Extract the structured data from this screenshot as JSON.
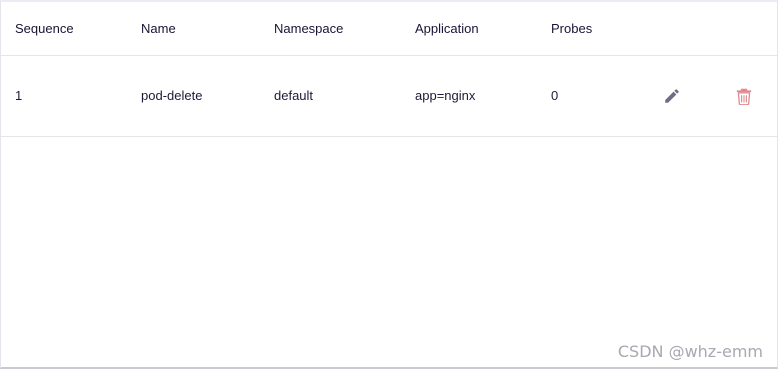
{
  "table": {
    "columns": [
      "Sequence",
      "Name",
      "Namespace",
      "Application",
      "Probes"
    ],
    "rows": [
      {
        "sequence": "1",
        "name": "pod-delete",
        "namespace": "default",
        "application": "app=nginx",
        "probes": "0"
      }
    ],
    "icons": {
      "edit": "pencil-icon",
      "delete": "trash-icon"
    }
  },
  "colors": {
    "edit_icon": "#6f6d86",
    "delete_icon": "#e0898f",
    "header_text": "#1b1435",
    "cell_text": "#1f1937",
    "border": "#e5e5ea"
  },
  "watermark": "CSDN @whz-emm"
}
